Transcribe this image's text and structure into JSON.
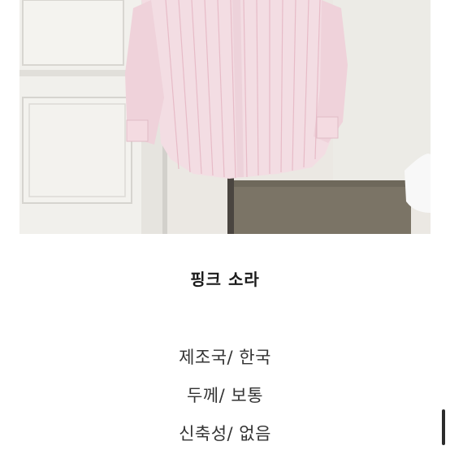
{
  "product": {
    "title": "핑크 소라",
    "specs": [
      "제조국/ 한국",
      "두께/ 보통",
      "신축성/ 없음"
    ]
  },
  "photo": {
    "subject": "shirt-photo"
  }
}
